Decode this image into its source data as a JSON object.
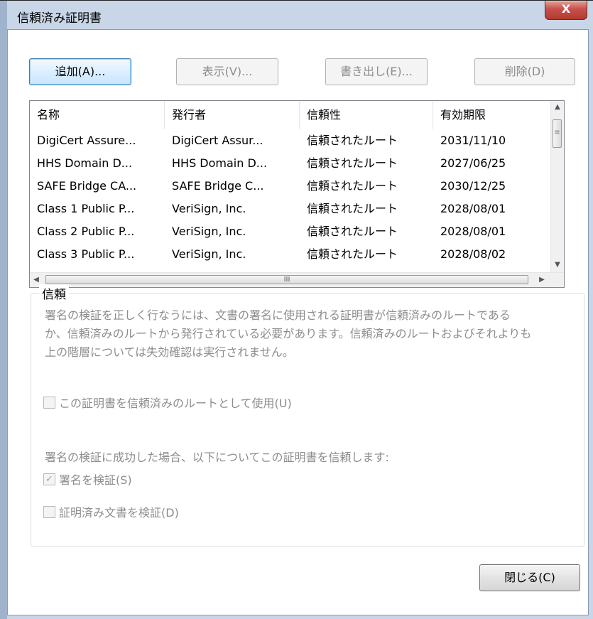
{
  "window": {
    "title": "信頼済み証明書",
    "close_glyph": "X"
  },
  "toolbar": {
    "add": "追加(A)...",
    "view": "表示(V)...",
    "export": "書き出し(E)...",
    "delete": "削除(D)"
  },
  "table": {
    "columns": [
      "名称",
      "発行者",
      "信頼性",
      "有効期限"
    ],
    "rows": [
      [
        "DigiCert Assure...",
        "DigiCert Assur...",
        "信頼されたルート",
        "2031/11/10"
      ],
      [
        "HHS Domain D...",
        "HHS Domain D...",
        "信頼されたルート",
        "2027/06/25"
      ],
      [
        "SAFE Bridge CA...",
        "SAFE Bridge C...",
        "信頼されたルート",
        "2030/12/25"
      ],
      [
        "Class 1 Public P...",
        "VeriSign, Inc.",
        "信頼されたルート",
        "2028/08/01"
      ],
      [
        "Class 2 Public P...",
        "VeriSign, Inc.",
        "信頼されたルート",
        "2028/08/01"
      ],
      [
        "Class 3 Public P...",
        "VeriSign, Inc.",
        "信頼されたルート",
        "2028/08/02"
      ]
    ],
    "hscroll_grip": "III",
    "vscroll_grip": "≡"
  },
  "trust": {
    "group_label": "信頼",
    "description_lines": [
      "署名の検証を正しく行なうには、文書の署名に使用される証明書が信頼済みのルートである",
      "か、信頼済みのルートから発行されている必要があります。信頼済みのルートおよびそれよりも",
      "上の階層については失効確認は実行されません。"
    ],
    "use_as_root": {
      "label": "この証明書を信頼済みのルートとして使用(U)",
      "checked": false
    },
    "trust_intro": "署名の検証に成功した場合、以下についてこの証明書を信頼します:",
    "verify_signatures": {
      "label": "署名を検証(S)",
      "checked": true,
      "mark": "✓"
    },
    "verify_certified": {
      "label": "証明済み文書を検証(D)",
      "checked": false
    }
  },
  "footer": {
    "close": "閉じる(C)"
  }
}
